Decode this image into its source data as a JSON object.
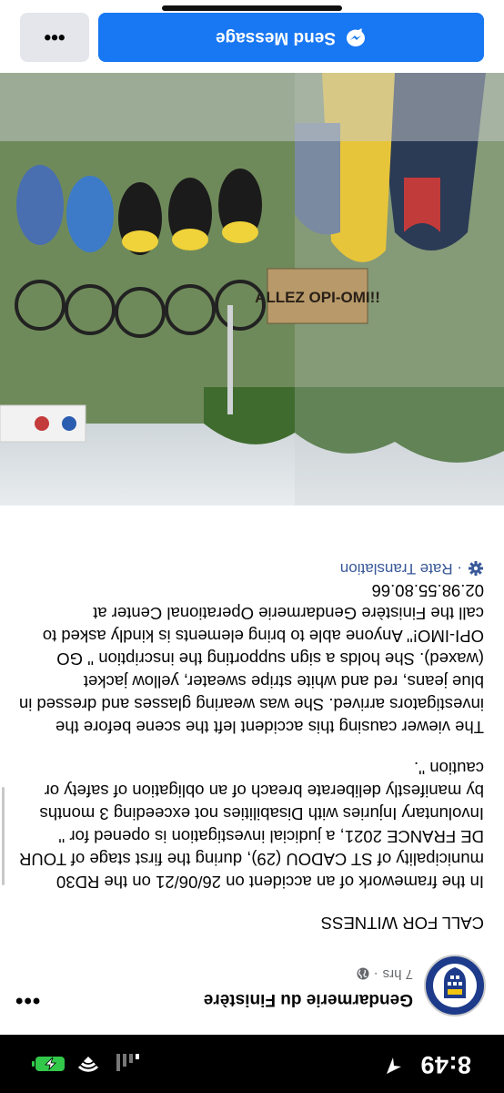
{
  "status_bar": {
    "time": "8:49"
  },
  "post": {
    "page_name": "Gendarmerie du Finistère",
    "time_ago": "7 hrs",
    "separator": "·",
    "more_label": "•••",
    "paragraphs": [
      "CALL FOR WITNESS",
      "In the framework of an accident on 26/06/21 on the RD30 municipality of ST CADOU (29), during the first stage of TOUR DE FRANCE 2021, a judicial investigation is opened for '' Involuntary Injuries with Disabilities not exceeding 3 months by manifestly deliberate breach of an obligation of safety or caution ''.",
      "The viewer causing this accident left the scene before the investigators arrived. She was wearing glasses and dressed in blue jeans, red and white stripe sweater, yellow jacket (waxed). She holds a sign supporting the inscription '' GO OPI-IMO!'' Anyone able to bring elements is kindly asked to call the Finistère Gendarmerie Operational Center at 02.98.55.80.66"
    ],
    "rate_translation": "· Rate Translation"
  },
  "photo": {
    "sign_text": "ALLEZ OPI-OMI!!"
  },
  "bottom_bar": {
    "send_message": "Send Message",
    "more_label": "•••"
  },
  "colors": {
    "accent": "#1877f2",
    "link": "#385898"
  },
  "icons": [
    "location-arrow-icon",
    "signal-icon",
    "wifi-icon",
    "battery-charging-icon",
    "globe-icon",
    "gear-icon",
    "messenger-icon"
  ]
}
